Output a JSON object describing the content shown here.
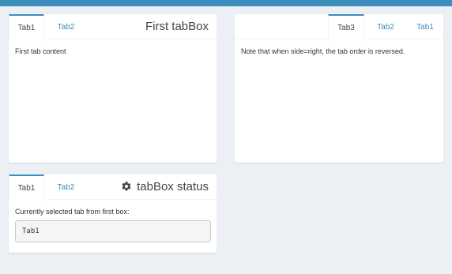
{
  "header": {
    "bar_color": "#3c8dbc"
  },
  "box1": {
    "tabs": [
      {
        "label": "Tab1",
        "active": true
      },
      {
        "label": "Tab2",
        "active": false
      }
    ],
    "title": "First tabBox",
    "content": "First tab content"
  },
  "box2": {
    "tabs": [
      {
        "label": "Tab3",
        "active": true
      },
      {
        "label": "Tab2",
        "active": false
      },
      {
        "label": "Tab1",
        "active": false
      }
    ],
    "content": "Note that when side=right, the tab order is reversed."
  },
  "box3": {
    "tabs": [
      {
        "label": "Tab1",
        "active": true
      },
      {
        "label": "Tab2",
        "active": false
      }
    ],
    "title": "tabBox status",
    "title_icon": "gear-icon",
    "label": "Currently selected tab from first box:",
    "output": "Tab1"
  },
  "colors": {
    "accent": "#3c8dbc",
    "background": "#ecf0f5",
    "box": "#ffffff"
  }
}
